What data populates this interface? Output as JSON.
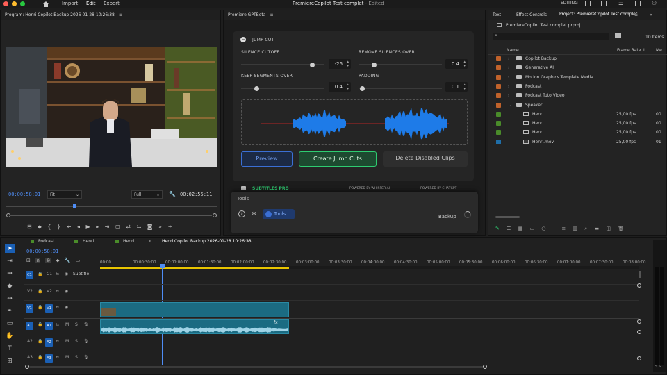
{
  "topbar": {
    "menu": [
      "Import",
      "Edit",
      "Export"
    ],
    "title": "PremiereCopilot Test complet",
    "title_suffix": " - Edited",
    "workspace": "EDITING"
  },
  "program": {
    "title": "Program: Henri Copilot Backup 2026-01-28 10:26:38",
    "timecode": "00:00:58:01",
    "fit": "Fit",
    "quality": "Full",
    "duration": "00:02:55:11"
  },
  "plugin": {
    "tab": "Premiere GPTBeta",
    "section_title": "JUMP CUT",
    "silence_cutoff": {
      "label": "SILENCE CUTOFF",
      "value": "-26",
      "level": 0.85
    },
    "remove_over": {
      "label": "REMOVE SILENCES OVER",
      "value": "0.4",
      "level": 0.18
    },
    "keep_over": {
      "label": "KEEP SEGMENTS OVER",
      "value": "0.4",
      "level": 0.18
    },
    "padding": {
      "label": "PADDING",
      "value": "0.1",
      "level": 0.04
    },
    "preview_label": "Preview",
    "create_label": "Create Jump Cuts",
    "delete_label": "Delete Disabled Clips",
    "subtitles_label": "SUBTITLES PRO",
    "whisper_label": "POWERED BY WHISPER AI",
    "chatgpt_label": "POWERED BY CHATGPT",
    "tools_header": "Tools",
    "tools_button": "Tools",
    "backup_label": "Backup",
    "colors": {
      "green": "#2ecc71",
      "blue": "#3b6fd4",
      "wave": "#1e7be8"
    }
  },
  "project": {
    "tabs": [
      "Text",
      "Effect Controls",
      "Project: PremiereCopilot Test complet"
    ],
    "file": "PremiereCopilot Test complet.prproj",
    "items_count": "10 Items",
    "col_name": "Name",
    "col_rate": "Frame Rate",
    "col_media": "Me",
    "rows": [
      {
        "name": "Copilot Backup",
        "type": "folder",
        "color": "#c0622b",
        "rate": "",
        "media": "",
        "indent": 0
      },
      {
        "name": "Generative AI",
        "type": "folder",
        "color": "#c0622b",
        "rate": "",
        "media": "",
        "indent": 0
      },
      {
        "name": "Motion Graphics Template Media",
        "type": "folder",
        "color": "#c0622b",
        "rate": "",
        "media": "",
        "indent": 0
      },
      {
        "name": "Podcast",
        "type": "folder",
        "color": "#c0622b",
        "rate": "",
        "media": "",
        "indent": 0
      },
      {
        "name": "Podcast Tuto Video",
        "type": "folder",
        "color": "#c0622b",
        "rate": "",
        "media": "",
        "indent": 0
      },
      {
        "name": "Speaker",
        "type": "folder-open",
        "color": "#c0622b",
        "rate": "",
        "media": "",
        "indent": 0
      },
      {
        "name": "Henri",
        "type": "sequence",
        "color": "#4a8c2a",
        "rate": "25,00 fps",
        "media": "00",
        "indent": 1
      },
      {
        "name": "Henri",
        "type": "sequence",
        "color": "#4a8c2a",
        "rate": "25,00 fps",
        "media": "00",
        "indent": 1
      },
      {
        "name": "Henri",
        "type": "sequence",
        "color": "#4a8c2a",
        "rate": "25,00 fps",
        "media": "00",
        "indent": 1
      },
      {
        "name": "Henri.mov",
        "type": "clip",
        "color": "#1f6ea8",
        "rate": "25,00 fps",
        "media": "01",
        "indent": 1
      }
    ]
  },
  "timeline": {
    "tabs": [
      "Podcast",
      "Henri",
      "Henri",
      "Henri Copilot Backup 2026-01-28 10:26:38"
    ],
    "timecode": "00:00:58:01",
    "ruler": [
      "00:00",
      "00:00:30:00",
      "00:01:00:00",
      "00:01:30:00",
      "00:02:00:00",
      "00:02:30:00",
      "00:03:00:00",
      "00:03:30:00",
      "00:04:00:00",
      "00:04:30:00",
      "00:05:00:00",
      "00:05:30:00",
      "00:06:00:00",
      "00:06:30:00",
      "00:07:00:00",
      "00:07:30:00",
      "00:08:00:00"
    ],
    "tracks": {
      "c1": "C1",
      "subtitle": "Subtitle",
      "v2": "V2",
      "v1": "V1",
      "a1": "A1",
      "a2": "A2",
      "a3": "A3",
      "m": "M",
      "s": "S"
    },
    "meter_label": "S S"
  }
}
